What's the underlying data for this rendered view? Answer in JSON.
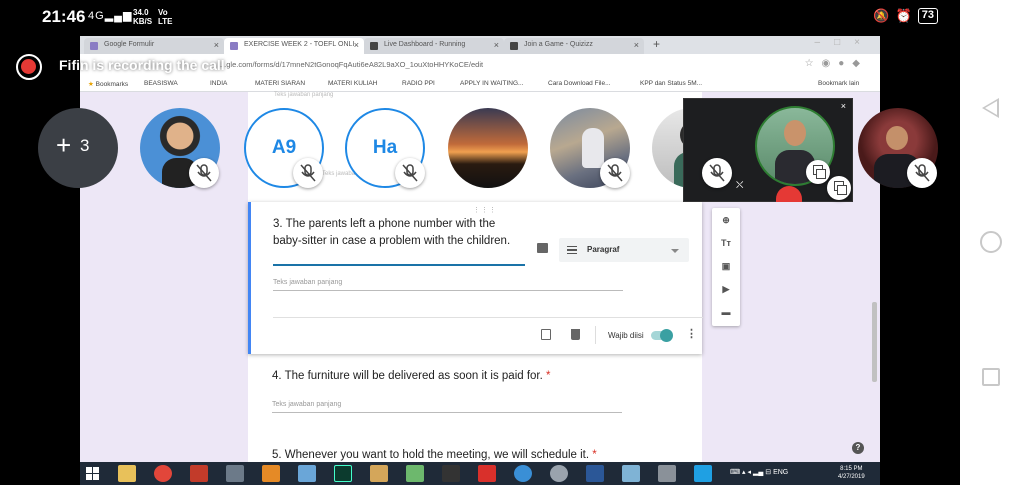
{
  "status_bar": {
    "time": "21:46",
    "signal": "4G",
    "speed": "34.0",
    "speed_unit": "KB/S",
    "network": "Vo",
    "network2": "LTE",
    "battery": "73"
  },
  "recording": {
    "text": "Fifin is recording the call"
  },
  "participants": {
    "more_count": "3",
    "tiles": [
      {
        "initials": ""
      },
      {
        "initials": "A9"
      },
      {
        "initials": "Ha"
      },
      {
        "initials": ""
      },
      {
        "initials": ""
      },
      {
        "initials": ""
      },
      {
        "initials": ""
      },
      {
        "initials": ""
      }
    ]
  },
  "browser": {
    "tabs": [
      {
        "label": "Google Formulir"
      },
      {
        "label": "EXERCISE WEEK 2 - TOEFL ONLI"
      },
      {
        "label": "Live Dashboard - Running"
      },
      {
        "label": "Join a Game - Quizizz"
      }
    ],
    "url": "...gle.com/forms/d/17mneN2tGonoqFqAuti6eA82L9aXO_1ouXtoHHYKoCE/edit",
    "bookmarks": [
      "Bookmarks",
      "BEASISWA",
      "INDIA",
      "MATERI SIARAN",
      "MATERI KULIAH",
      "RADIO PPI",
      "APPLY IN WAITING...",
      "Cara Download File...",
      "KPP dan Status 5M...",
      "Bookmark lain"
    ]
  },
  "form": {
    "prev_hint": "Teks jawaban panjang",
    "q3_text": "3. The parents left a phone number with the baby-sitter in case a problem with the children.",
    "answer_type": "Paragraf",
    "q3_hint": "Teks jawaban panjang",
    "required_label": "Wajib diisi",
    "q4_text": "4. The furniture will be delivered as soon it is paid for.",
    "q4_hint": "Teks jawaban panjang",
    "q5_text": "5. Whenever you want to hold the meeting, we will schedule it.",
    "required_mark": "*",
    "side_tools": [
      "add-question",
      "title",
      "image",
      "video",
      "section"
    ]
  },
  "taskbar": {
    "tray_lang": "ENG",
    "clock_time": "8:15 PM",
    "clock_date": "4/27/2019"
  },
  "colors": {
    "record_red": "#e53935",
    "avatar_blue": "#1e88e5",
    "form_accent": "#4285f4",
    "toggle_teal": "#3aa0a2"
  }
}
